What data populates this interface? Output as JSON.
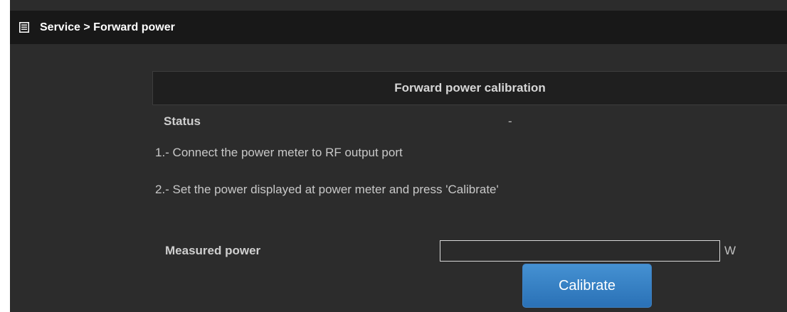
{
  "header": {
    "icon": "list-icon",
    "title": "Service > Forward power"
  },
  "panel": {
    "title": "Forward power calibration",
    "status_label": "Status",
    "status_value": "-",
    "step1": "1.- Connect the power meter to RF output port",
    "step2": "2.- Set the power displayed at power meter and press 'Calibrate'",
    "measured_label": "Measured power",
    "measured_value": "",
    "unit": "W",
    "calibrate_label": "Calibrate"
  },
  "colors": {
    "background": "#2c2c2c",
    "titlebar": "#181818",
    "button": "#3a83c6"
  }
}
